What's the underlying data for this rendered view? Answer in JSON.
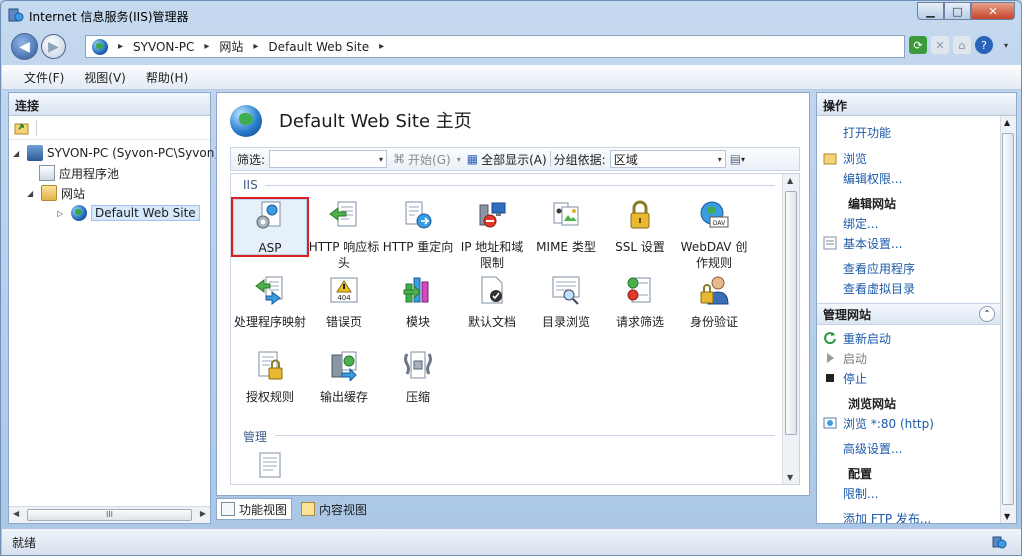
{
  "window": {
    "title": "Internet 信息服务(IIS)管理器",
    "minimize": "▁",
    "maximize": "□",
    "close": "✕"
  },
  "nav": {
    "back": "◀",
    "forward": "▶",
    "breadcrumbs": [
      "SYVON-PC",
      "网站",
      "Default Web Site"
    ],
    "separator": "▸"
  },
  "menu": [
    "文件(F)",
    "视图(V)",
    "帮助(H)"
  ],
  "connections": {
    "header": "连接",
    "tree": [
      {
        "label": "SYVON-PC (Syvon-PC\\Syvon)",
        "expander": "◢",
        "icon": "server-icon"
      },
      {
        "label": "应用程序池",
        "expander": "",
        "icon": "app-pool-icon"
      },
      {
        "label": "网站",
        "expander": "◢",
        "icon": "sites-folder-icon"
      },
      {
        "label": "Default Web Site",
        "expander": "▷",
        "icon": "globe-icon"
      }
    ],
    "scroll_thumb": "III"
  },
  "main": {
    "title": "Default Web Site 主页",
    "filter": {
      "label": "筛选:",
      "value": "",
      "start": "开始(G)",
      "show_all": "全部显示(A)",
      "group_by_label": "分组依据:",
      "group_by_value": "区域"
    },
    "groups": [
      {
        "label": "IIS"
      },
      {
        "label": "管理"
      }
    ],
    "features": [
      {
        "label": "ASP",
        "icon": "asp-icon",
        "selected": true
      },
      {
        "label": "HTTP 响应标头",
        "icon": "http-response-headers-icon"
      },
      {
        "label": "HTTP 重定向",
        "icon": "http-redirect-icon"
      },
      {
        "label": "IP 地址和域限制",
        "icon": "ip-domain-restrictions-icon"
      },
      {
        "label": "MIME 类型",
        "icon": "mime-types-icon"
      },
      {
        "label": "SSL 设置",
        "icon": "ssl-lock-icon"
      },
      {
        "label": "WebDAV 创作规则",
        "icon": "webdav-icon"
      },
      {
        "label": "处理程序映射",
        "icon": "handler-mappings-icon"
      },
      {
        "label": "错误页",
        "icon": "error-pages-icon"
      },
      {
        "label": "模块",
        "icon": "modules-icon"
      },
      {
        "label": "默认文档",
        "icon": "default-document-icon"
      },
      {
        "label": "目录浏览",
        "icon": "directory-browsing-icon"
      },
      {
        "label": "请求筛选",
        "icon": "request-filtering-icon"
      },
      {
        "label": "身份验证",
        "icon": "authentication-icon"
      },
      {
        "label": "授权规则",
        "icon": "authorization-rules-icon"
      },
      {
        "label": "输出缓存",
        "icon": "output-caching-icon"
      },
      {
        "label": "压缩",
        "icon": "compression-icon"
      }
    ],
    "tabs": [
      {
        "label": "功能视图",
        "active": true
      },
      {
        "label": "内容视图",
        "active": false
      }
    ]
  },
  "actions": {
    "header": "操作",
    "items": [
      {
        "type": "link",
        "label": "打开功能"
      },
      {
        "type": "link",
        "label": "浏览",
        "icon": "explore-icon"
      },
      {
        "type": "link",
        "label": "编辑权限..."
      },
      {
        "type": "head",
        "label": "编辑网站"
      },
      {
        "type": "link",
        "label": "绑定..."
      },
      {
        "type": "link",
        "label": "基本设置...",
        "icon": "settings-icon"
      },
      {
        "type": "link",
        "label": "查看应用程序"
      },
      {
        "type": "link",
        "label": "查看虚拟目录"
      },
      {
        "type": "section",
        "label": "管理网站"
      },
      {
        "type": "link",
        "label": "重新启动",
        "icon": "restart-icon"
      },
      {
        "type": "disabled",
        "label": "启动",
        "icon": "start-icon"
      },
      {
        "type": "link",
        "label": "停止",
        "icon": "stop-icon"
      },
      {
        "type": "head",
        "label": "浏览网站"
      },
      {
        "type": "link",
        "label": "浏览 *:80 (http)",
        "icon": "browse-icon"
      },
      {
        "type": "link",
        "label": "高级设置..."
      },
      {
        "type": "head",
        "label": "配置"
      },
      {
        "type": "link",
        "label": "限制..."
      },
      {
        "type": "link",
        "label": "添加 FTP 发布..."
      }
    ]
  },
  "status": {
    "text": "就绪"
  },
  "colors": {
    "link": "#1c5aa8",
    "selection_outline": "#e02020",
    "accent": "#2a7fd0"
  }
}
